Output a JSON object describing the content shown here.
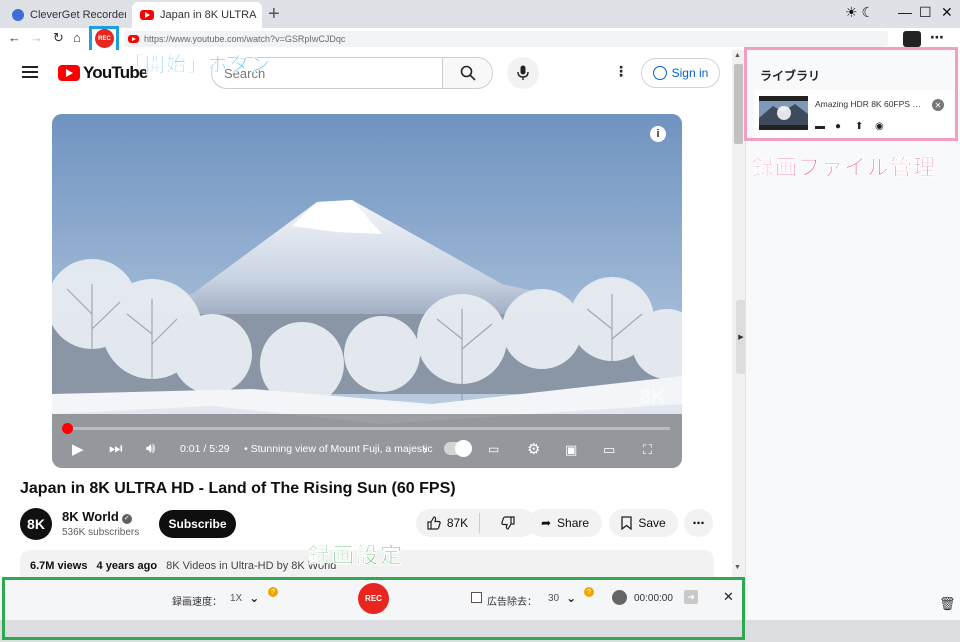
{
  "browser": {
    "tabs": [
      {
        "label": "CleverGet Recorder"
      },
      {
        "label": "Japan in 8K ULTRA"
      }
    ],
    "new_tab": "+",
    "theme_toggle": "☀ ☾",
    "window_controls": {
      "minimize": "—",
      "maximize": "☐",
      "close": "✕"
    },
    "nav": {
      "back": "←",
      "forward": "→",
      "reload": "↻",
      "home": "⌂"
    },
    "rec_button": "REC",
    "url": "https://www.youtube.com/watch?v=GSRpIwCJDqc",
    "more": "⋯"
  },
  "annotations": {
    "start_button": "「開始」ボタン",
    "recording_settings": "録画設定",
    "file_management": "録画ファイル管理"
  },
  "youtube": {
    "logo_text": "YouTube",
    "search_placeholder": "Search",
    "sign_in": "Sign in",
    "player": {
      "time": "0:01 / 5:29",
      "chapter": "• Stunning view of Mount Fuji, a majestic",
      "watermark": "8K",
      "progress": 0.003
    },
    "video_title": "Japan in 8K ULTRA HD - Land of The Rising Sun (60 FPS)",
    "channel": {
      "avatar_text": "8K",
      "name": "8K World",
      "subscribers": "536K subscribers"
    },
    "subscribe": "Subscribe",
    "likes": "87K",
    "share": "Share",
    "save": "Save",
    "description": {
      "views": "6.7M views",
      "age": "4 years ago",
      "tags": "8K Videos in Ultra-HD by 8K World"
    }
  },
  "recorder_bar": {
    "speed_label": "録画速度：",
    "speed_value": "1X",
    "rec": "REC",
    "ad_remove_label": "広告除去：",
    "ad_remove_value": "30",
    "timer": "00:00:00",
    "help": "?"
  },
  "library": {
    "title": "ライブラリ",
    "items": [
      {
        "name": "Amazing HDR 8K 60FPS Vi..."
      }
    ]
  },
  "colors": {
    "rec_red": "#e8261f",
    "annotation_blue": "#1aa0e0",
    "annotation_green": "#2fa84f",
    "annotation_pink": "#e64f9a",
    "youtube_red": "#ff0000",
    "link_blue": "#065fd4"
  },
  "icons": {
    "search": "search-icon",
    "mic": "microphone-icon",
    "play": "play-icon",
    "next": "next-icon",
    "volume": "volume-icon",
    "settings": "gear-icon",
    "fullscreen": "fullscreen-icon",
    "trash": "trash-icon"
  }
}
